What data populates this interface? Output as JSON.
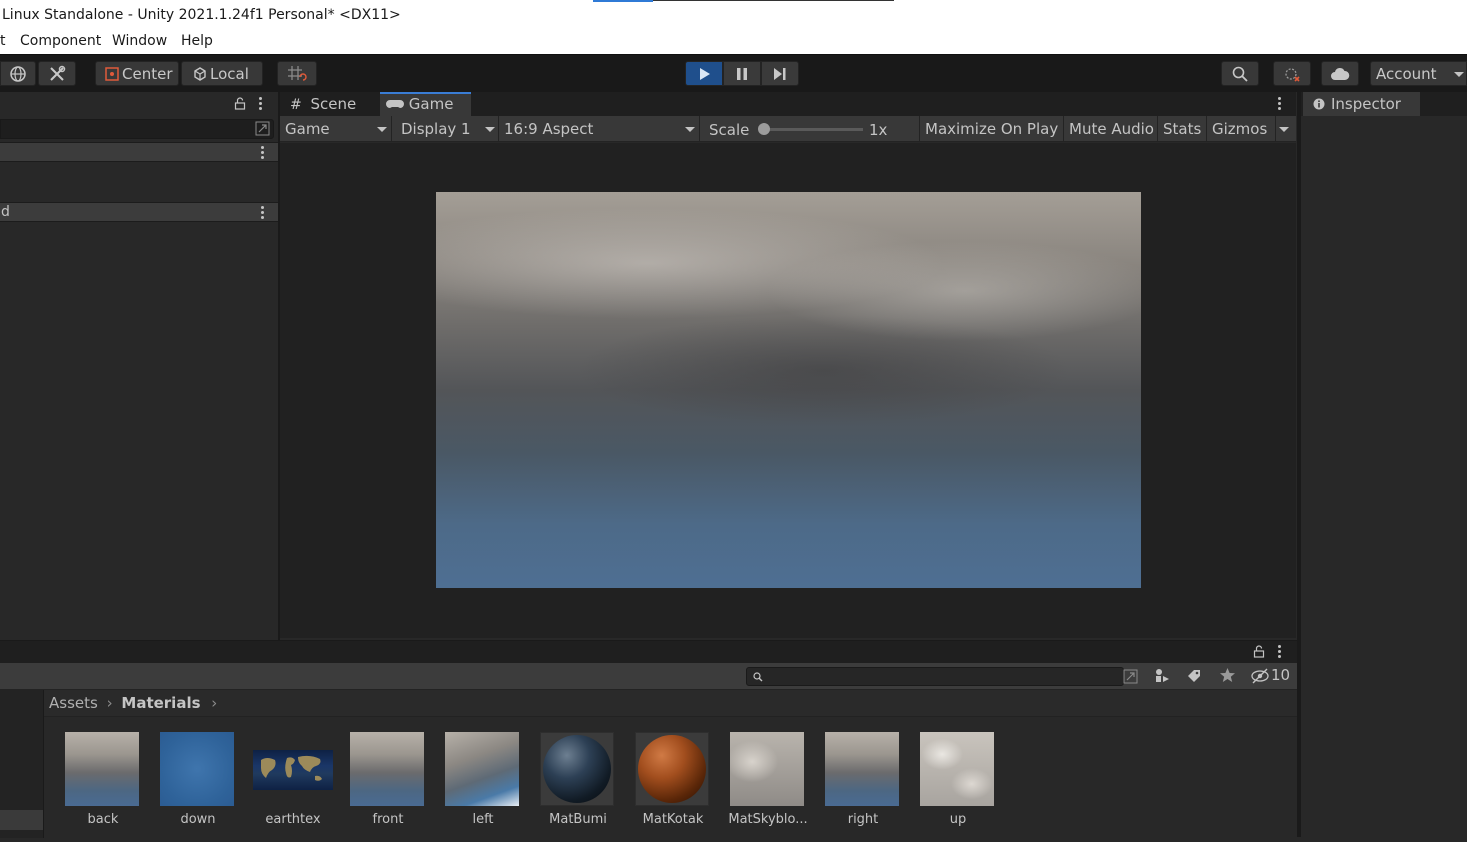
{
  "window": {
    "title": "Linux Standalone - Unity 2021.1.24f1 Personal* <DX11>"
  },
  "menu": {
    "items": [
      "t",
      "Component",
      "Window",
      "Help"
    ]
  },
  "toolbar": {
    "center_label": "Center",
    "local_label": "Local",
    "account_label": "Account"
  },
  "hierarchy": {
    "scene_row_1": "",
    "scene_row_2": "d"
  },
  "game": {
    "tabs": {
      "scene": "Scene",
      "game": "Game"
    },
    "display_mode": "Game",
    "display": "Display 1",
    "aspect": "16:9 Aspect",
    "scale_label": "Scale",
    "scale_value": "1x",
    "maximize": "Maximize On Play",
    "mute": "Mute Audio",
    "stats": "Stats",
    "gizmos": "Gizmos"
  },
  "inspector": {
    "tab": "Inspector"
  },
  "project": {
    "hidden_count": "10",
    "breadcrumb": {
      "root": "Assets",
      "current": "Materials"
    },
    "assets": [
      {
        "label": "back",
        "kind": "sky"
      },
      {
        "label": "down",
        "kind": "water"
      },
      {
        "label": "earthtex",
        "kind": "earth-map"
      },
      {
        "label": "front",
        "kind": "sky"
      },
      {
        "label": "left",
        "kind": "sky"
      },
      {
        "label": "MatBumi",
        "kind": "earth-sphere"
      },
      {
        "label": "MatKotak",
        "kind": "copper-sphere"
      },
      {
        "label": "MatSkyblo...",
        "kind": "sky-clouds"
      },
      {
        "label": "right",
        "kind": "sky"
      },
      {
        "label": "up",
        "kind": "clouds"
      }
    ]
  },
  "colors": {
    "accent": "#3a7dd5",
    "play_active": "#1f4f8c",
    "panel": "#282828",
    "toolbar": "#191919"
  }
}
